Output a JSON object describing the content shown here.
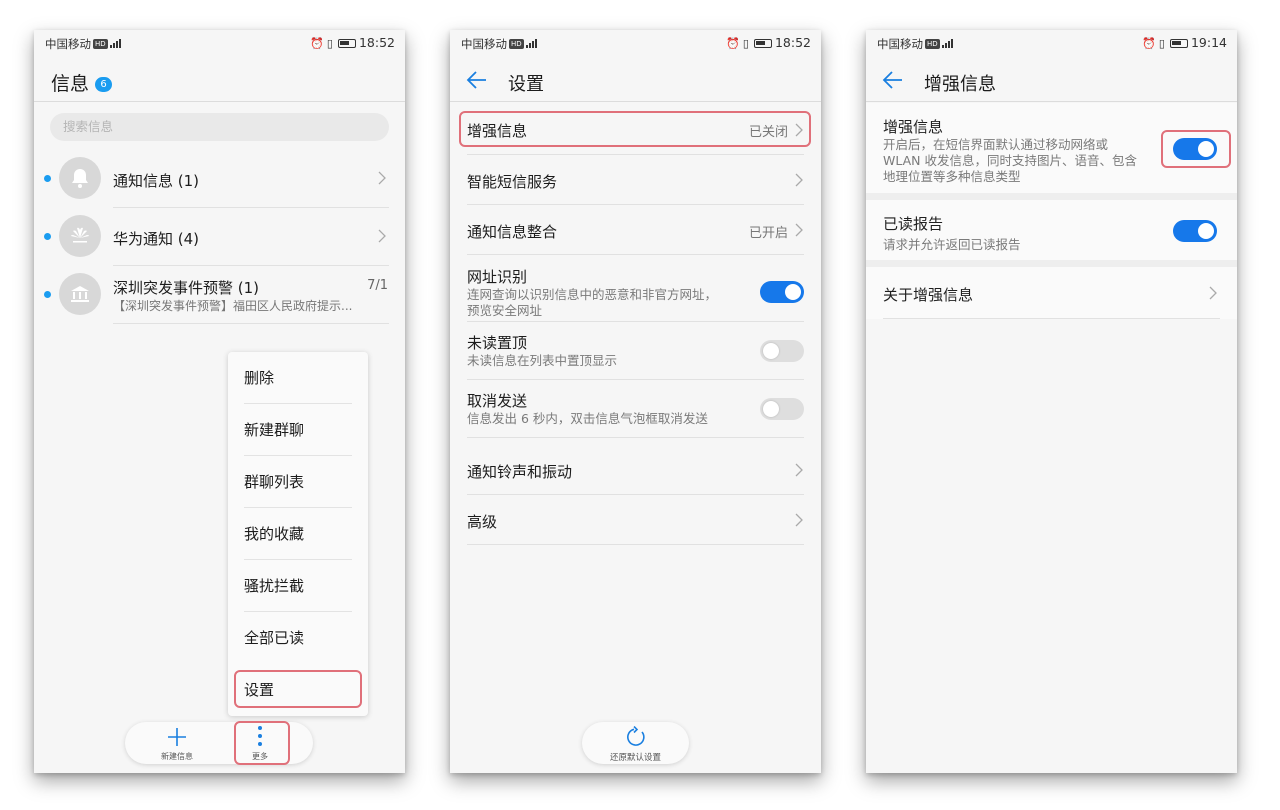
{
  "screen1": {
    "status": {
      "carrier": "中国移动",
      "hd": "HD",
      "net": "4G",
      "time": "18:52"
    },
    "title": "信息",
    "badge": "6",
    "search_placeholder": "搜索信息",
    "conversations": [
      {
        "name": "通知信息 (1)",
        "icon": "bell-icon"
      },
      {
        "name": "华为通知 (4)",
        "icon": "huawei-logo-icon"
      },
      {
        "name": "深圳突发事件预警 (1)",
        "date": "7/1",
        "preview": "【深圳突发事件预警】福田区人民政府提示...",
        "icon": "government-building-icon"
      }
    ],
    "menu": [
      "删除",
      "新建群聊",
      "群聊列表",
      "我的收藏",
      "骚扰拦截",
      "全部已读",
      "设置"
    ],
    "bottom": {
      "new_label": "新建信息",
      "more_label": "更多"
    }
  },
  "screen2": {
    "status": {
      "carrier": "中国移动",
      "hd": "HD",
      "net": "4G",
      "time": "18:52"
    },
    "title": "设置",
    "items": [
      {
        "title": "增强信息",
        "value": "已关闭"
      },
      {
        "title": "智能短信服务"
      },
      {
        "title": "通知信息整合",
        "value": "已开启"
      },
      {
        "title": "网址识别",
        "sub1": "连网查询以识别信息中的恶意和非官方网址，",
        "sub2": "预览安全网址",
        "toggle": "on"
      },
      {
        "title": "未读置顶",
        "sub1": "未读信息在列表中置顶显示",
        "toggle": "off"
      },
      {
        "title": "取消发送",
        "sub1": "信息发出 6 秒内，双击信息气泡框取消发送",
        "toggle": "off"
      },
      {
        "title": "通知铃声和振动"
      },
      {
        "title": "高级"
      }
    ],
    "restore_label": "还原默认设置"
  },
  "screen3": {
    "status": {
      "carrier": "中国移动",
      "hd": "HD",
      "net": "4G",
      "time": "19:14"
    },
    "title": "增强信息",
    "enhanced": {
      "title": "增强信息",
      "desc1": "开启后，在短信界面默认通过移动网络或",
      "desc2": "WLAN 收发信息，同时支持图片、语音、包含",
      "desc3": "地理位置等多种信息类型",
      "toggle": "on"
    },
    "read_report": {
      "title": "已读报告",
      "desc": "请求并允许返回已读报告",
      "toggle": "on"
    },
    "about": {
      "title": "关于增强信息"
    }
  },
  "colors": {
    "accent": "#1678ea",
    "badge": "#1a9cf0",
    "highlight": "#e0707a"
  }
}
